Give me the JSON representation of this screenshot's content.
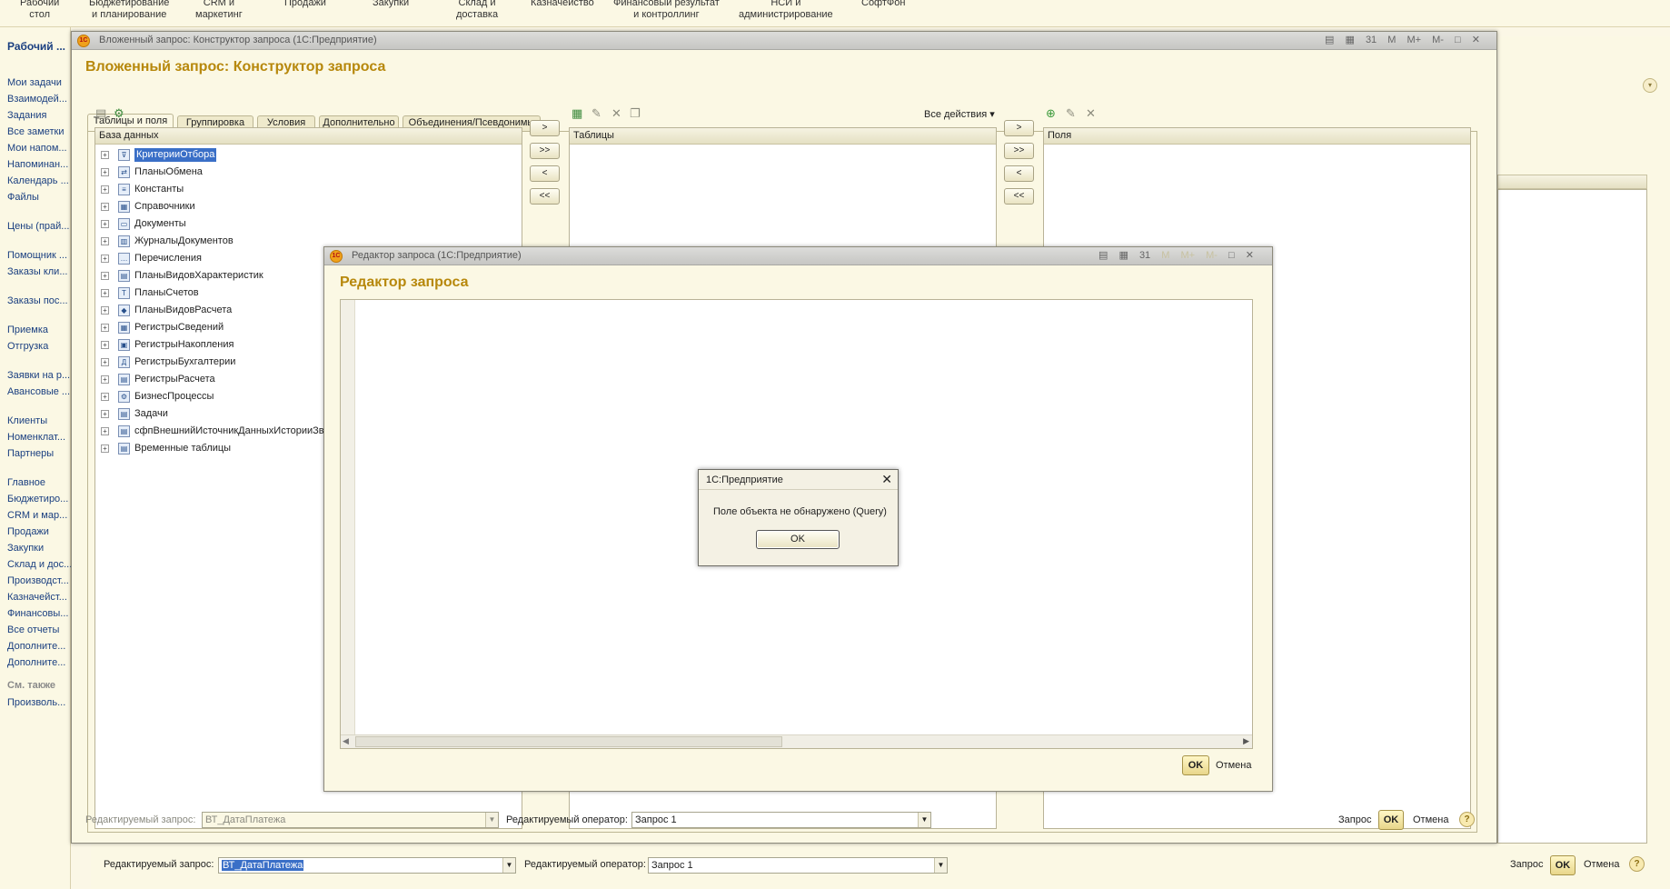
{
  "sections": [
    {
      "label": "Рабочий\nстол"
    },
    {
      "label": "Бюджетирование\nи планирование"
    },
    {
      "label": "CRM и\nмаркетинг"
    },
    {
      "label": "Продажи"
    },
    {
      "label": "Закупки"
    },
    {
      "label": "Склад и\nдоставка"
    },
    {
      "label": "Казначейство"
    },
    {
      "label": "Финансовый результат\nи контроллинг"
    },
    {
      "label": "НСИ и\nадминистрирование"
    },
    {
      "label": "СофтФон"
    }
  ],
  "leftnav": {
    "header": "Рабочий ...",
    "items": [
      "Мои задачи",
      "Взаимодей...",
      "Задания",
      "Все заметки",
      "Мои напом...",
      "Напоминан...",
      "Календарь ...",
      "Файлы",
      "Цены (прай...",
      "Помощник ...",
      "Заказы кли...",
      "Заказы пос...",
      "Приемка",
      "Отгрузка",
      "Заявки на р...",
      "Авансовые ...",
      "Клиенты",
      "Номенклат...",
      "Партнеры",
      "Главное",
      "Бюджетиро...",
      "CRM и мар...",
      "Продажи",
      "Закупки",
      "Склад и дос...",
      "Производст...",
      "Казначейст...",
      "Финансовы...",
      "Все отчеты",
      "Дополните...",
      "Дополните..."
    ],
    "see_also": "См. также",
    "extra": "Произволь..."
  },
  "bg_bottom": {
    "query_label": "Редактируемый запрос:",
    "query_value": "ВТ_ДатаПлатежа",
    "operator_label": "Редактируемый оператор:",
    "operator_value": "Запрос 1",
    "btn_query": "Запрос",
    "btn_ok": "OK",
    "btn_cancel": "Отмена",
    "help": "?"
  },
  "constructor": {
    "window_caption": "Вложенный запрос: Конструктор запроса  (1С:Предприятие)",
    "title": "Вложенный запрос: Конструктор запроса",
    "tools": [
      "▤",
      "▦",
      "31",
      "M",
      "M+",
      "M-",
      "□",
      "✕"
    ],
    "tabs": [
      "Таблицы и поля",
      "Группировка",
      "Условия",
      "Дополнительно",
      "Объединения/Псевдонимы"
    ],
    "db_header": "База данных",
    "tables_header": "Таблицы",
    "fields_header": "Поля",
    "all_actions": "Все действия ▾",
    "arrows": [
      ">",
      ">>",
      "<",
      "<<"
    ],
    "tree": [
      {
        "text": "КритерииОтбора",
        "icon": "⊽"
      },
      {
        "text": "ПланыОбмена",
        "icon": "⇄"
      },
      {
        "text": "Константы",
        "icon": "≡"
      },
      {
        "text": "Справочники",
        "icon": "▦"
      },
      {
        "text": "Документы",
        "icon": "▭"
      },
      {
        "text": "ЖурналыДокументов",
        "icon": "▥"
      },
      {
        "text": "Перечисления",
        "icon": "…"
      },
      {
        "text": "ПланыВидовХарактеристик",
        "icon": "▤"
      },
      {
        "text": "ПланыСчетов",
        "icon": "Т"
      },
      {
        "text": "ПланыВидовРасчета",
        "icon": "◆"
      },
      {
        "text": "РегистрыСведений",
        "icon": "▦"
      },
      {
        "text": "РегистрыНакопления",
        "icon": "▣"
      },
      {
        "text": "РегистрыБухгалтерии",
        "icon": "Д"
      },
      {
        "text": "РегистрыРасчета",
        "icon": "▤"
      },
      {
        "text": "БизнесПроцессы",
        "icon": "⚙"
      },
      {
        "text": "Задачи",
        "icon": "▤"
      },
      {
        "text": "сфпВнешнийИсточникДанныхИсторииЗвонков",
        "icon": "▤"
      },
      {
        "text": "Временные таблицы",
        "icon": "▤"
      }
    ],
    "bottom": {
      "query_label": "Редактируемый запрос:",
      "query_value": "ВТ_ДатаПлатежа",
      "operator_label": "Редактируемый оператор:",
      "operator_value": "Запрос 1",
      "btn_query": "Запрос",
      "btn_ok": "OK",
      "btn_cancel": "Отмена",
      "help": "?"
    }
  },
  "editor": {
    "window_caption": "Редактор запроса  (1С:Предприятие)",
    "title": "Редактор запроса",
    "btn_ok": "OK",
    "btn_cancel": "Отмена"
  },
  "msgbox": {
    "caption": "1С:Предприятие",
    "message": "Поле объекта не обнаружено (Query)",
    "btn_ok": "OK"
  }
}
